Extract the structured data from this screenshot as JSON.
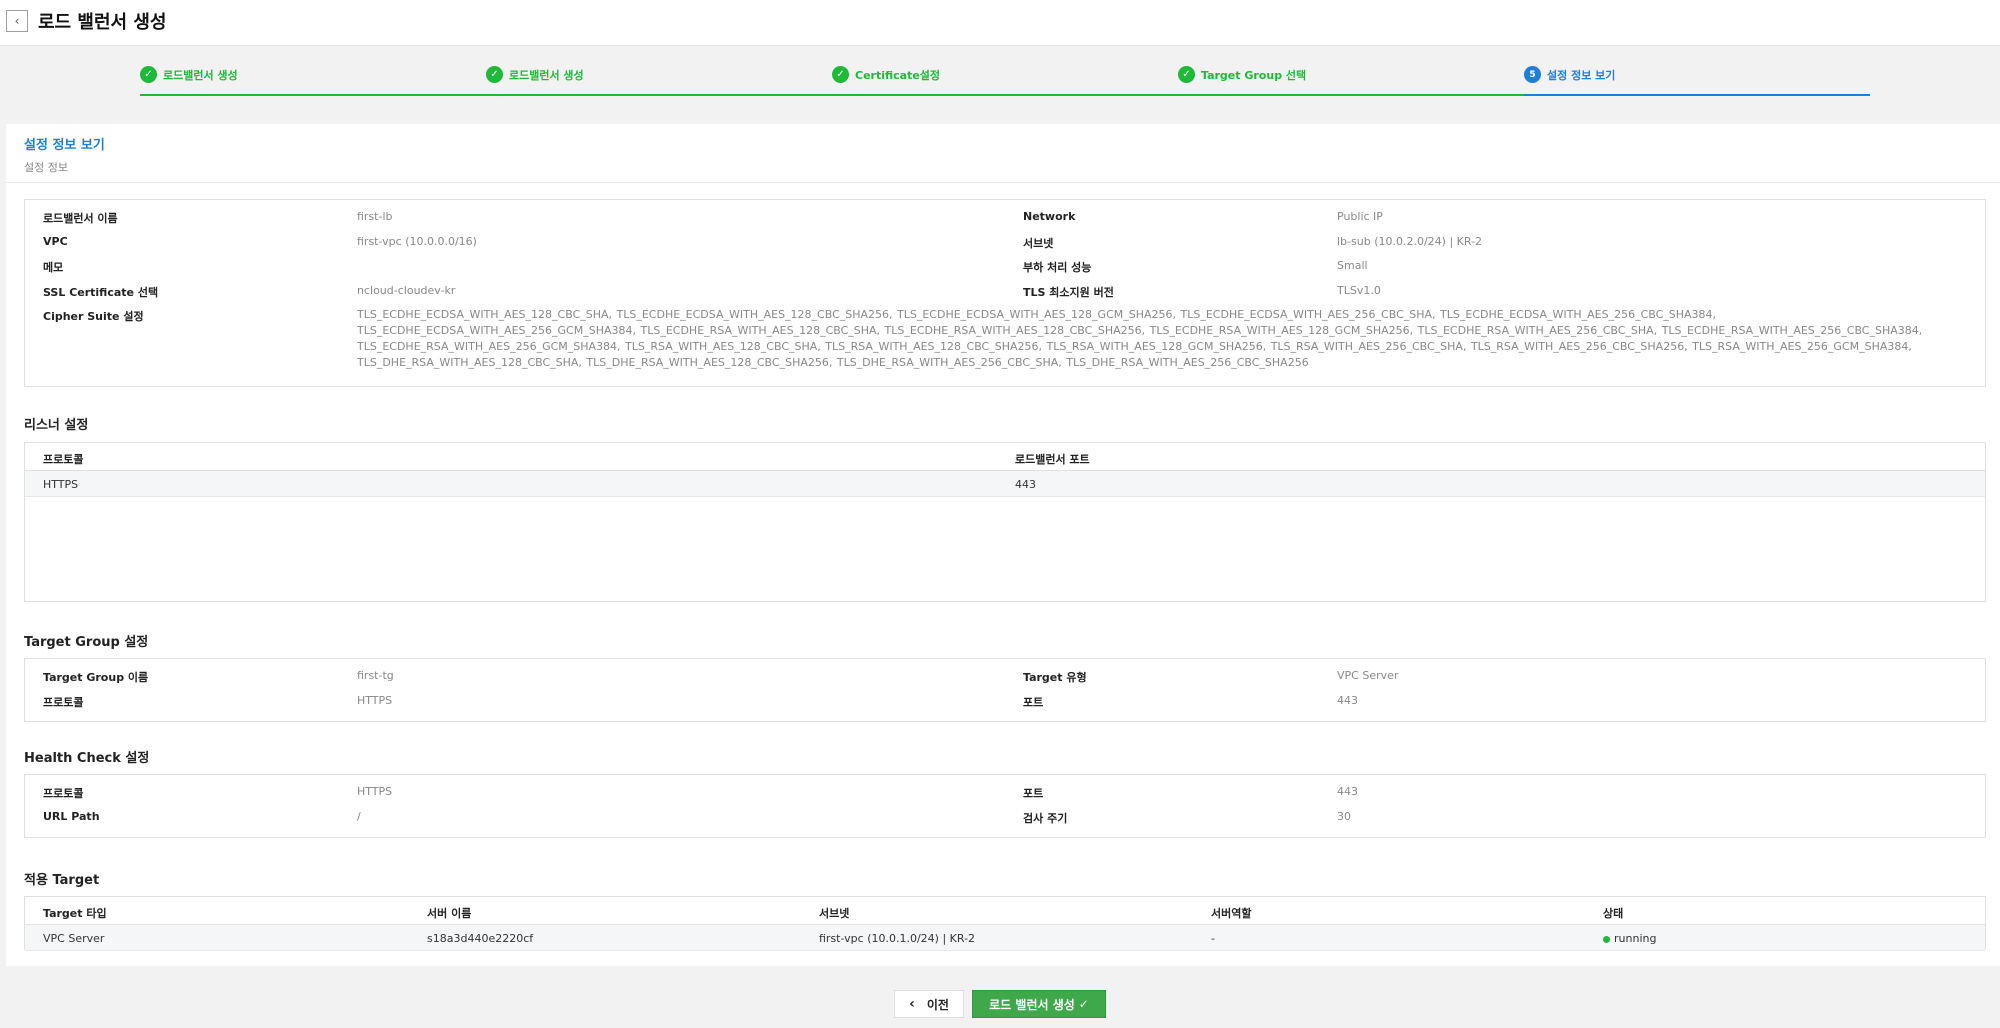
{
  "header": {
    "title": "로드 밸런서 생성",
    "back_icon": "‹"
  },
  "stepper": {
    "steps": [
      {
        "label": "로드밸런서 생성",
        "marker": "✓"
      },
      {
        "label": "로드밸런서 생성",
        "marker": "✓"
      },
      {
        "label": "Certificate설정",
        "marker": "✓"
      },
      {
        "label": "Target Group 선택",
        "marker": "✓"
      },
      {
        "label": "설정 정보 보기",
        "marker": "5"
      }
    ],
    "colors": {
      "done": "#1fb93a",
      "current": "#1f7fd6"
    }
  },
  "summary": {
    "title": "설정 정보 보기",
    "subtitle": "설정 정보",
    "left": [
      {
        "label": "로드밸런서 이름",
        "value": "first-lb"
      },
      {
        "label": "VPC",
        "value": "first-vpc (10.0.0.0/16)"
      },
      {
        "label": "메모",
        "value": ""
      },
      {
        "label": "SSL Certificate 선택",
        "value": "ncloud-cloudev-kr"
      }
    ],
    "right": [
      {
        "label": "Network",
        "value": "Public IP"
      },
      {
        "label": "서브넷",
        "value": "lb-sub (10.0.2.0/24) | KR-2"
      },
      {
        "label": "부하 처리 성능",
        "value": "Small"
      },
      {
        "label": "TLS 최소지원 버전",
        "value": "TLSv1.0"
      }
    ],
    "cipher_label": "Cipher Suite 설정",
    "cipher_value": "TLS_ECDHE_ECDSA_WITH_AES_128_CBC_SHA, TLS_ECDHE_ECDSA_WITH_AES_128_CBC_SHA256, TLS_ECDHE_ECDSA_WITH_AES_128_GCM_SHA256, TLS_ECDHE_ECDSA_WITH_AES_256_CBC_SHA, TLS_ECDHE_ECDSA_WITH_AES_256_CBC_SHA384, TLS_ECDHE_ECDSA_WITH_AES_256_GCM_SHA384, TLS_ECDHE_RSA_WITH_AES_128_CBC_SHA, TLS_ECDHE_RSA_WITH_AES_128_CBC_SHA256, TLS_ECDHE_RSA_WITH_AES_128_GCM_SHA256, TLS_ECDHE_RSA_WITH_AES_256_CBC_SHA, TLS_ECDHE_RSA_WITH_AES_256_CBC_SHA384, TLS_ECDHE_RSA_WITH_AES_256_GCM_SHA384, TLS_RSA_WITH_AES_128_CBC_SHA, TLS_RSA_WITH_AES_128_CBC_SHA256, TLS_RSA_WITH_AES_128_GCM_SHA256, TLS_RSA_WITH_AES_256_CBC_SHA, TLS_RSA_WITH_AES_256_CBC_SHA256, TLS_RSA_WITH_AES_256_GCM_SHA384, TLS_DHE_RSA_WITH_AES_128_CBC_SHA, TLS_DHE_RSA_WITH_AES_128_CBC_SHA256, TLS_DHE_RSA_WITH_AES_256_CBC_SHA, TLS_DHE_RSA_WITH_AES_256_CBC_SHA256"
  },
  "listener": {
    "title": "리스너 설정",
    "columns": [
      "프로토콜",
      "로드밸런서 포트"
    ],
    "rows": [
      [
        "HTTPS",
        "443"
      ]
    ]
  },
  "target_group": {
    "title": "Target Group 설정",
    "left": [
      {
        "label": "Target Group 이름",
        "value": "first-tg"
      },
      {
        "label": "프로토콜",
        "value": "HTTPS"
      }
    ],
    "right": [
      {
        "label": "Target 유형",
        "value": "VPC Server"
      },
      {
        "label": "포트",
        "value": "443"
      }
    ]
  },
  "health_check": {
    "title": "Health Check 설정",
    "left": [
      {
        "label": "프로토콜",
        "value": "HTTPS"
      },
      {
        "label": "URL Path",
        "value": "/"
      }
    ],
    "right": [
      {
        "label": "포트",
        "value": "443"
      },
      {
        "label": "검사 주기",
        "value": "30"
      }
    ]
  },
  "targets": {
    "title": "적용 Target",
    "columns": [
      "Target 타입",
      "서버 이름",
      "서브넷",
      "서버역할",
      "상태"
    ],
    "rows": [
      [
        "VPC Server",
        "s18a3d440e2220cf",
        "first-vpc (10.0.1.0/24) | KR-2",
        "-",
        "running"
      ]
    ],
    "status_color": "#1fb93a"
  },
  "footer": {
    "prev_label": "이전",
    "prev_icon": "‹",
    "create_label": "로드 밸런서 생성",
    "create_icon": "✓"
  }
}
